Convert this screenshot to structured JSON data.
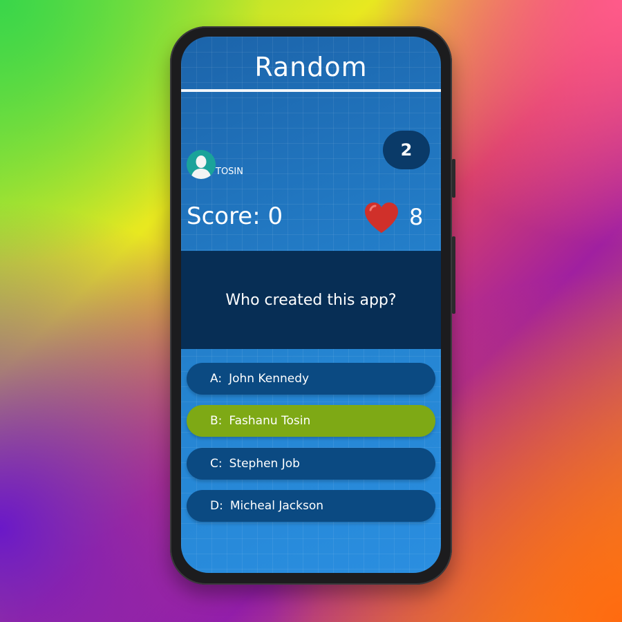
{
  "header": {
    "title": "Random"
  },
  "question_counter": "2",
  "player": {
    "name": "TOSIN"
  },
  "score": {
    "label": "Score: 0"
  },
  "lives": {
    "count": "8"
  },
  "question": {
    "text": "Who created this app?"
  },
  "options": [
    {
      "letter": "A:",
      "text": "John Kennedy",
      "state": "default"
    },
    {
      "letter": "B:",
      "text": "Fashanu Tosin",
      "state": "selected"
    },
    {
      "letter": "C:",
      "text": "Stephen Job",
      "state": "default"
    },
    {
      "letter": "D:",
      "text": "Micheal Jackson",
      "state": "default"
    }
  ],
  "colors": {
    "screen_blue": "#1f73bb",
    "question_panel": "#072e55",
    "option_default": "#0b4a82",
    "option_selected": "#7ea915",
    "heart": "#d0302a"
  }
}
